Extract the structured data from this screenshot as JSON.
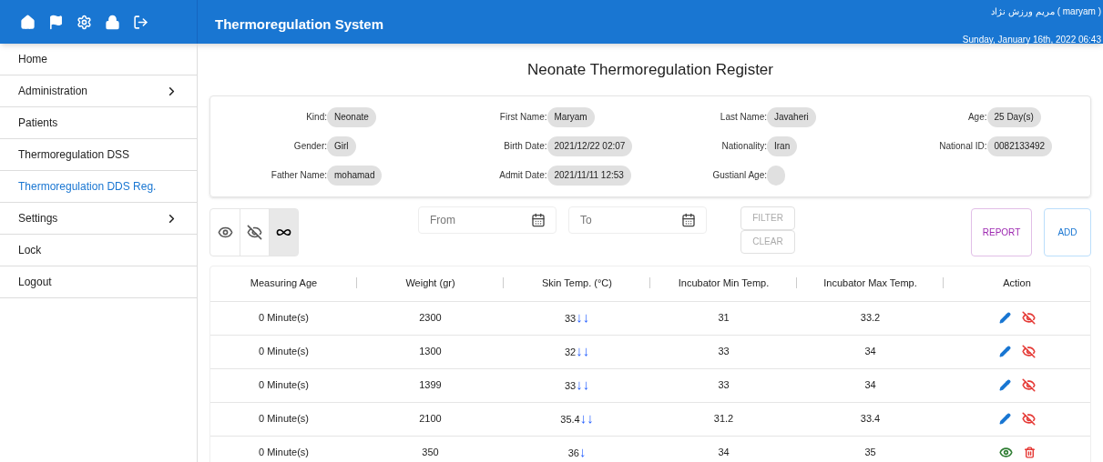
{
  "app_bar": {
    "title": "Thermoregulation System",
    "user": "مریم ورزش نژاد ( maryam )",
    "datetime": "Sunday, January 16th, 2022 06:43"
  },
  "sidebar": {
    "items": [
      {
        "label": "Home",
        "selected": false,
        "expandable": false
      },
      {
        "label": "Administration",
        "selected": false,
        "expandable": true
      },
      {
        "label": "Patients",
        "selected": false,
        "expandable": false
      },
      {
        "label": "Thermoregulation DSS",
        "selected": false,
        "expandable": false
      },
      {
        "label": "Thermoregulation DDS Reg.",
        "selected": true,
        "expandable": false
      },
      {
        "label": "Settings",
        "selected": false,
        "expandable": true
      },
      {
        "label": "Lock",
        "selected": false,
        "expandable": false
      },
      {
        "label": "Logout",
        "selected": false,
        "expandable": false
      }
    ]
  },
  "page_title": "Neonate Thermoregulation Register",
  "patient_info": [
    {
      "label": "Kind:",
      "value": "Neonate"
    },
    {
      "label": "First Name:",
      "value": "Maryam"
    },
    {
      "label": "Last Name:",
      "value": "Javaheri"
    },
    {
      "label": "Age:",
      "value": "25 Day(s)"
    },
    {
      "label": "Gender:",
      "value": "Girl"
    },
    {
      "label": "Birth Date:",
      "value": "2021/12/22 02:07"
    },
    {
      "label": "Nationality:",
      "value": "Iran"
    },
    {
      "label": "National ID:",
      "value": "0082133492"
    },
    {
      "label": "Father Name:",
      "value": "mohamad"
    },
    {
      "label": "Admit Date:",
      "value": "2021/11/11 12:53"
    },
    {
      "label": "Gustianl Age:"
    }
  ],
  "view_toggles": [
    {
      "kind": "visible",
      "selected": false
    },
    {
      "kind": "hidden",
      "selected": false
    },
    {
      "kind": "all",
      "selected": true
    }
  ],
  "filters": {
    "from_placeholder": "From",
    "to_placeholder": "To",
    "filter_button": "FILTER",
    "clear_button": "CLEAR",
    "report_button": "REPORT",
    "add_button": "ADD"
  },
  "table": {
    "columns": [
      "Measuring Age",
      "Weight (gr)",
      "Skin Temp. (°C)",
      "Incubator Min Temp.",
      "Incubator Max Temp.",
      "Action"
    ],
    "rows": [
      {
        "age": "0 Minute(s)",
        "weight": "2300",
        "skin": "33",
        "trend": "↓↓",
        "min": "31",
        "max": "33.2",
        "kind": "visible"
      },
      {
        "age": "0 Minute(s)",
        "weight": "1300",
        "skin": "32",
        "trend": "↓↓",
        "min": "33",
        "max": "34",
        "kind": "visible"
      },
      {
        "age": "0 Minute(s)",
        "weight": "1399",
        "skin": "33",
        "trend": "↓↓",
        "min": "33",
        "max": "34",
        "kind": "visible"
      },
      {
        "age": "0 Minute(s)",
        "weight": "2100",
        "skin": "35.4",
        "trend": "↓↓",
        "min": "31.2",
        "max": "33.4",
        "kind": "visible"
      },
      {
        "age": "0 Minute(s)",
        "weight": "350",
        "skin": "36",
        "trend": "↓",
        "min": "34",
        "max": "35",
        "kind": "hidden"
      }
    ]
  }
}
